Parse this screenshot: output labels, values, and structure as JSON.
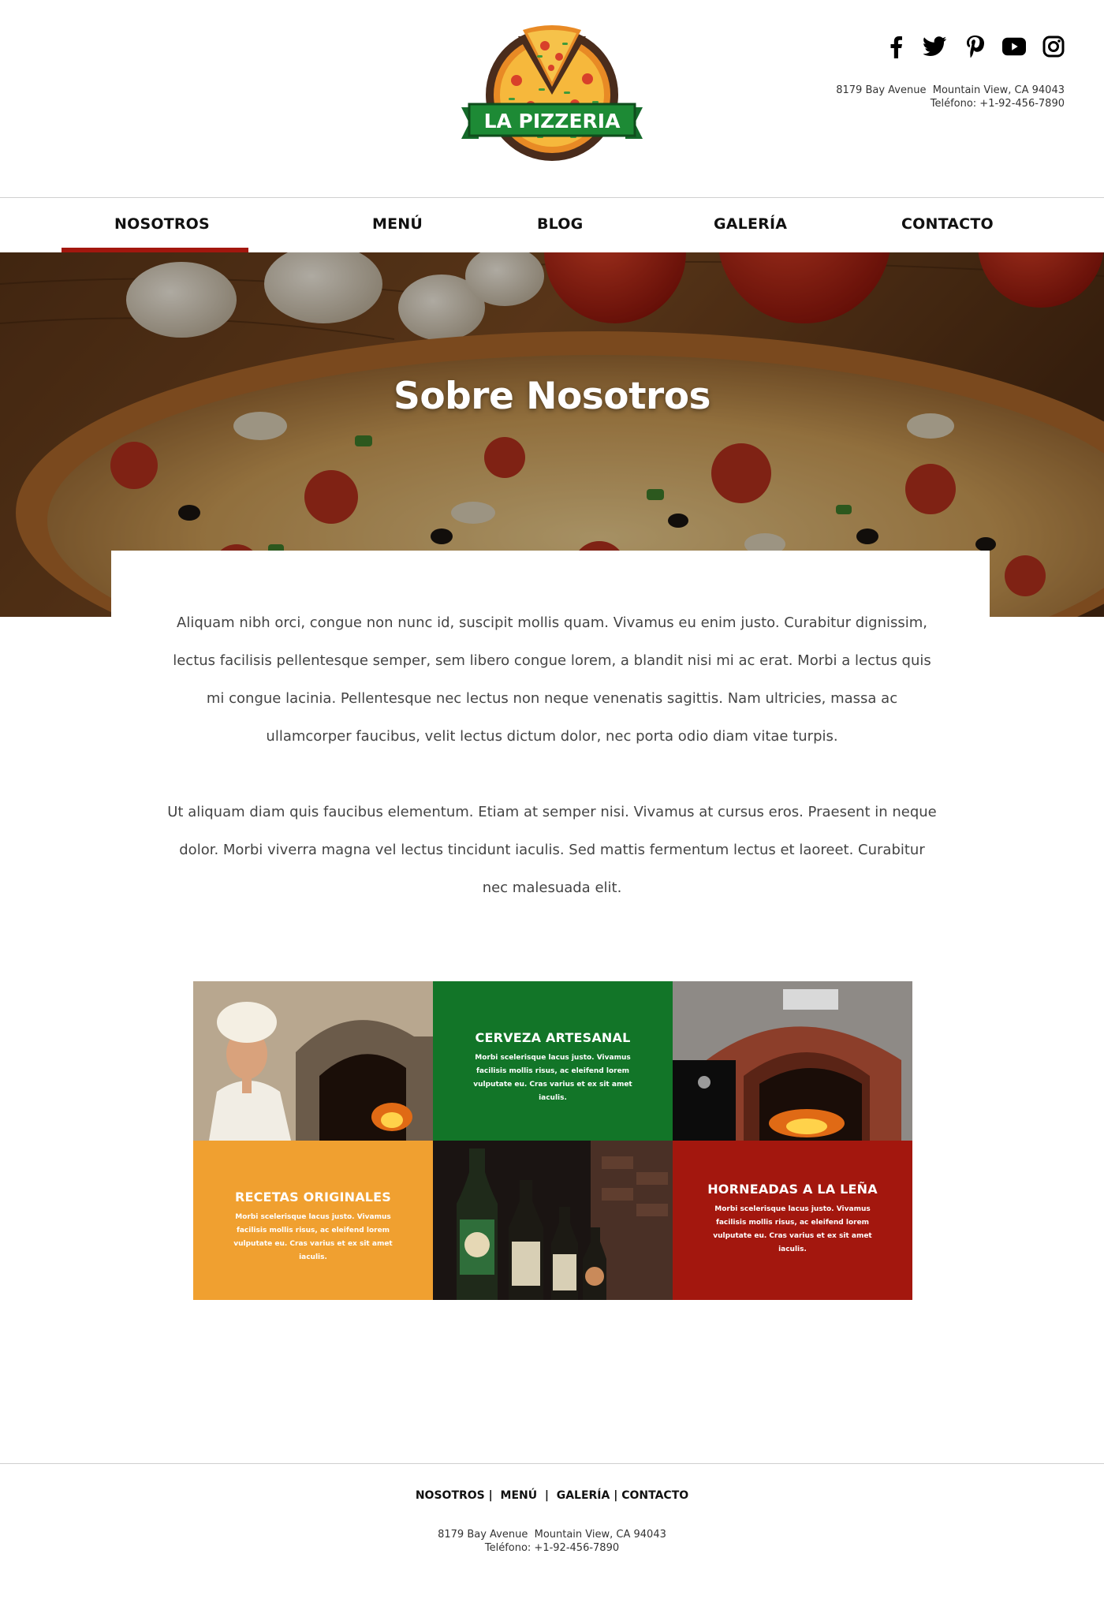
{
  "header": {
    "logo_text": "LA PIZZERIA",
    "address_line1": "8179 Bay Avenue  Mountain View, CA 94043",
    "address_line2": "Teléfono: +1-92-456-7890",
    "social": [
      "facebook-icon",
      "twitter-icon",
      "pinterest-icon",
      "youtube-icon",
      "instagram-icon"
    ]
  },
  "nav": {
    "items": [
      "NOSOTROS",
      "MENÚ",
      "BLOG",
      "GALERÍA",
      "CONTACTO"
    ],
    "active": "NOSOTROS",
    "accent_color": "#a3170e"
  },
  "hero": {
    "title": "Sobre Nosotros"
  },
  "content": {
    "paragraph1": "Aliquam nibh orci, congue non nunc id, suscipit mollis quam. Vivamus eu enim justo. Curabitur dignissim, lectus facilisis pellentesque semper, sem libero congue lorem, a blandit nisi mi ac erat. Morbi a lectus quis mi congue lacinia. Pellentesque nec lectus non neque venenatis sagittis. Nam ultricies, massa ac ullamcorper faucibus, velit lectus dictum dolor, nec porta odio diam vitae turpis.",
    "paragraph2": "Ut aliquam diam quis faucibus elementum. Etiam at semper nisi. Vivamus at cursus eros. Praesent in neque dolor. Morbi viverra magna vel lectus tincidunt iaculis. Sed mattis fermentum lectus et laoreet. Curabitur nec malesuada elit."
  },
  "features": {
    "cerveza": {
      "title": "CERVEZA ARTESANAL",
      "text": "Morbi scelerisque lacus justo. Vivamus facilisis mollis risus, ac eleifend lorem vulputate eu. Cras varius et ex sit amet iaculis.",
      "color": "#127528"
    },
    "recetas": {
      "title": "RECETAS ORIGINALES",
      "text": "Morbi scelerisque lacus justo. Vivamus facilisis mollis risus, ac eleifend lorem vulputate eu. Cras varius et ex sit amet iaculis.",
      "color": "#f0a030"
    },
    "horneadas": {
      "title": "HORNEADAS A LA LEÑA",
      "text": "Morbi scelerisque lacus justo. Vivamus facilisis mollis risus, ac eleifend lorem vulputate eu. Cras varius et ex sit amet iaculis.",
      "color": "#a3170e"
    }
  },
  "footer": {
    "nav": [
      "NOSOTROS",
      "MENÚ",
      "GALERÍA",
      "CONTACTO"
    ],
    "address_line1": "8179 Bay Avenue  Mountain View, CA 94043",
    "address_line2": "Teléfono: +1-92-456-7890"
  }
}
